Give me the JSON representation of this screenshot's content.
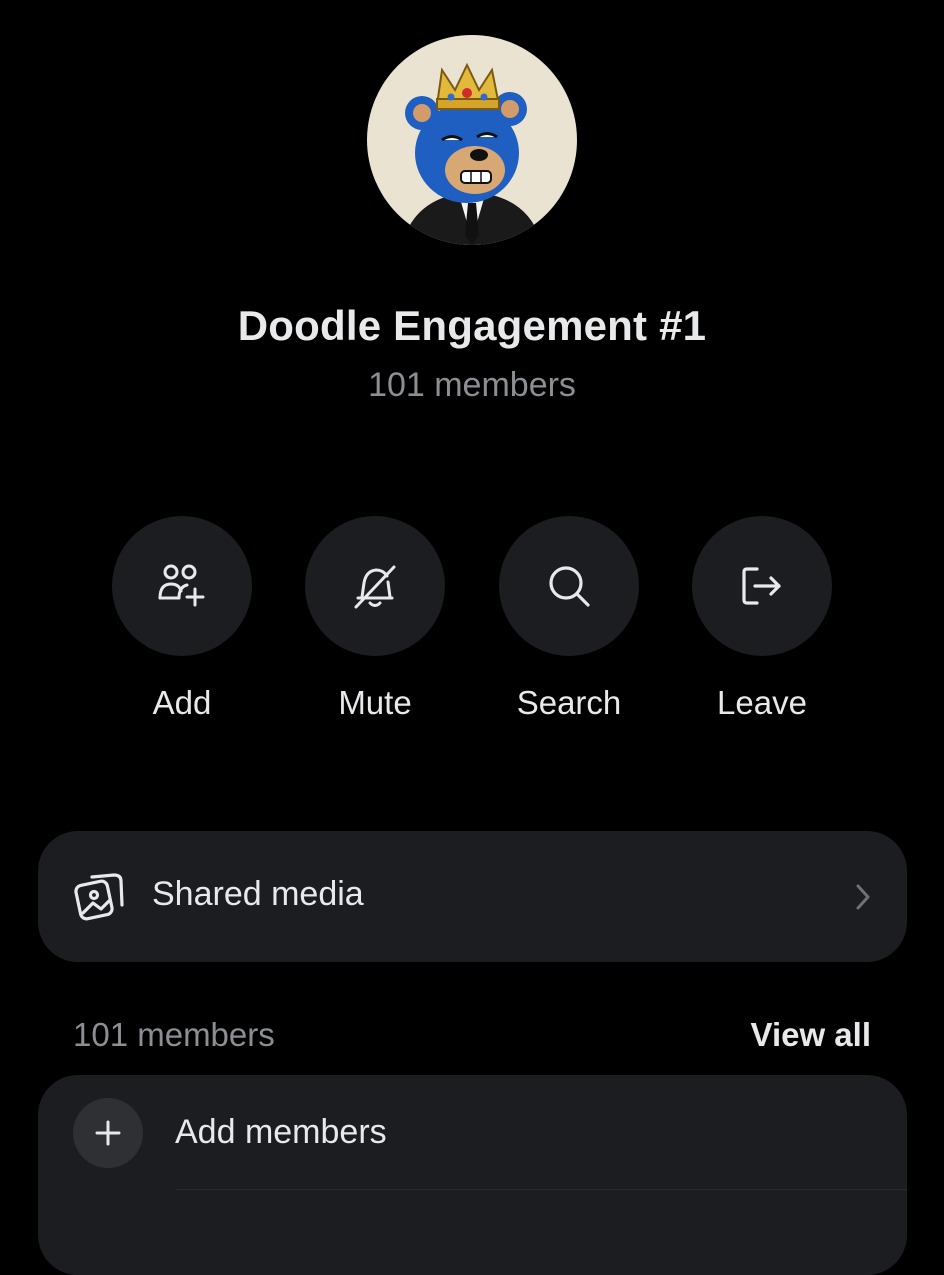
{
  "group": {
    "title": "Doodle Engagement #1",
    "subtitle": "101 members"
  },
  "actions": [
    {
      "label": "Add",
      "icon": "add-people-icon"
    },
    {
      "label": "Mute",
      "icon": "bell-off-icon"
    },
    {
      "label": "Search",
      "icon": "search-icon"
    },
    {
      "label": "Leave",
      "icon": "leave-icon"
    }
  ],
  "shared_media": {
    "label": "Shared media",
    "icon": "media-gallery-icon"
  },
  "members": {
    "count_label": "101 members",
    "view_all_label": "View all",
    "add_label": "Add members"
  },
  "colors": {
    "background": "#000000",
    "surface": "#1c1d20",
    "text_primary": "#e7e9ea",
    "text_secondary": "#8b8f94"
  }
}
